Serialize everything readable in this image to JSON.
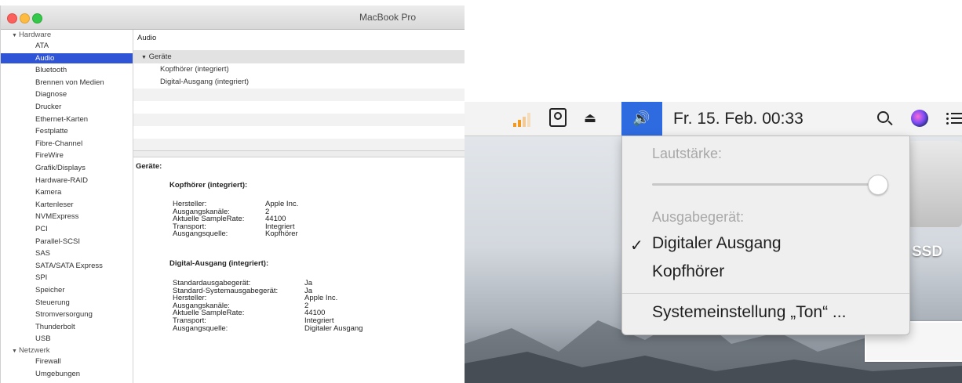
{
  "window": {
    "title": "MacBook Pro",
    "sidebar": {
      "hardware_label": "Hardware",
      "hardware_items": [
        "ATA",
        "Audio",
        "Bluetooth",
        "Brennen von Medien",
        "Diagnose",
        "Drucker",
        "Ethernet-Karten",
        "Festplatte",
        "Fibre-Channel",
        "FireWire",
        "Grafik/Displays",
        "Hardware-RAID",
        "Kamera",
        "Kartenleser",
        "NVMExpress",
        "PCI",
        "Parallel-SCSI",
        "SAS",
        "SATA/SATA Express",
        "SPI",
        "Speicher",
        "Steuerung",
        "Stromversorgung",
        "Thunderbolt",
        "USB"
      ],
      "selected": "Audio",
      "network_label": "Netzwerk",
      "network_items": [
        "Firewall",
        "Umgebungen"
      ]
    },
    "content": {
      "heading": "Audio",
      "group_label": "Geräte",
      "devices": [
        "Kopfhörer (integriert)",
        "Digital-Ausgang (integriert)"
      ],
      "detail": {
        "title": "Geräte:",
        "device1": {
          "title": "Kopfhörer (integriert):",
          "rows": [
            {
              "k": "Hersteller:",
              "v": "Apple Inc."
            },
            {
              "k": "Ausgangskanäle:",
              "v": "2"
            },
            {
              "k": "Aktuelle SampleRate:",
              "v": "44100"
            },
            {
              "k": "Transport:",
              "v": "Integriert"
            },
            {
              "k": "Ausgangsquelle:",
              "v": "Kopfhörer"
            }
          ]
        },
        "device2": {
          "title": "Digital-Ausgang (integriert):",
          "rows": [
            {
              "k": "Standardausgabegerät:",
              "v": "Ja"
            },
            {
              "k": "Standard-Systemausgabegerät:",
              "v": "Ja"
            },
            {
              "k": "Hersteller:",
              "v": "Apple Inc."
            },
            {
              "k": "Ausgangskanäle:",
              "v": "2"
            },
            {
              "k": "Aktuelle SampleRate:",
              "v": "44100"
            },
            {
              "k": "Transport:",
              "v": "Integriert"
            },
            {
              "k": "Ausgangsquelle:",
              "v": "Digitaler Ausgang"
            }
          ]
        }
      }
    }
  },
  "menubar": {
    "clock": "Fr. 15. Feb.  00:33",
    "icons": [
      "wifi-icon",
      "disk-icon",
      "eject-icon",
      "volume-icon",
      "search-icon",
      "siri-icon",
      "notification-list-icon"
    ],
    "accent_color": "#2f6be0"
  },
  "volume_menu": {
    "volume_label": "Lautstärke:",
    "volume_level": 0.97,
    "output_label": "Ausgabegerät:",
    "outputs": [
      "Digitaler Ausgang",
      "Kopfhörer"
    ],
    "selected_output": "Digitaler Ausgang",
    "settings_item": "Systemeinstellung „Ton“ ..."
  },
  "desktop": {
    "disk_label": "SSD"
  }
}
